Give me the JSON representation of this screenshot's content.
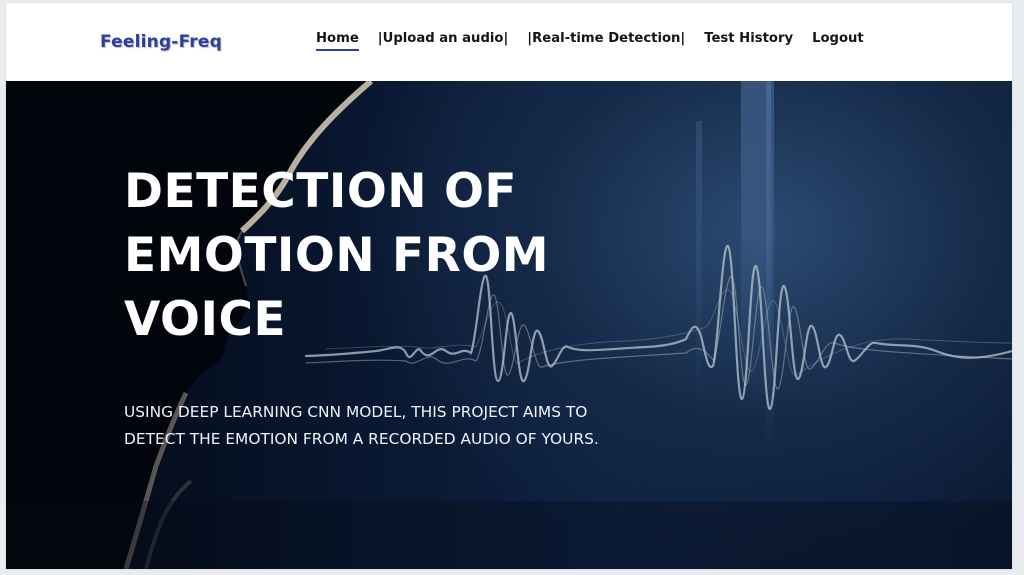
{
  "brand": {
    "name": "Feeling-Freq"
  },
  "nav": {
    "items": [
      {
        "label": "Home",
        "active": true
      },
      {
        "label": "|Upload an audio|",
        "active": false
      },
      {
        "label": "|Real-time Detection|",
        "active": false
      },
      {
        "label": "Test History",
        "active": false
      },
      {
        "label": "Logout",
        "active": false
      }
    ]
  },
  "hero": {
    "title_lines": [
      "DETECTION OF",
      "EMOTION FROM",
      "VOICE"
    ],
    "subtitle_lines": [
      "USING DEEP LEARNING CNN MODEL, THIS PROJECT AIMS TO",
      "DETECT THE EMOTION FROM A RECORDED AUDIO OF YOURS."
    ]
  },
  "colors": {
    "brand": "#2f3f9e",
    "nav_text": "#151515",
    "hero_dark": "#081730",
    "hero_text": "#ffffff"
  }
}
